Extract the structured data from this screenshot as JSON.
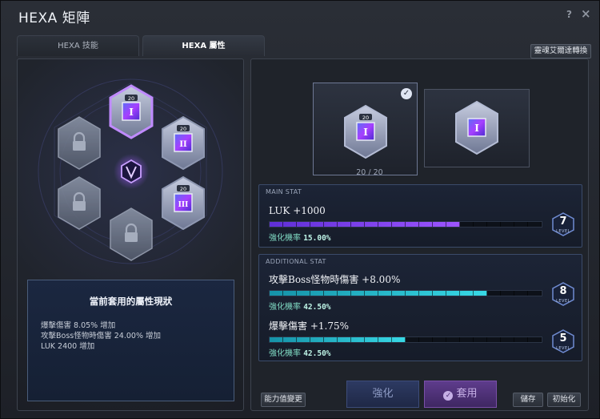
{
  "window": {
    "title": "HEXA 矩陣",
    "help_icon": "?",
    "close_icon": "×"
  },
  "tabs": [
    {
      "label": "HEXA 技能"
    },
    {
      "label": "HEXA 屬性"
    }
  ],
  "convert_button": "靈魂艾爾達轉換",
  "left": {
    "nodes": [
      {
        "level": "20",
        "state": "selected",
        "roman": "I"
      },
      {
        "level": "20",
        "state": "unlocked",
        "roman": "II"
      },
      {
        "level": "20",
        "state": "unlocked",
        "roman": "III"
      },
      {
        "state": "locked"
      },
      {
        "state": "locked"
      },
      {
        "state": "locked"
      }
    ],
    "status": {
      "title": "當前套用的屬性現狀",
      "lines": [
        "爆擊傷害 8.05% 增加",
        "攻擊Boss怪物時傷害 24.00% 增加",
        "LUK 2400 增加"
      ]
    }
  },
  "right": {
    "cards": [
      {
        "level": "20",
        "roman": "I",
        "checked": true
      },
      {
        "roman": "I",
        "checked": false
      }
    ],
    "count": {
      "current": "20",
      "sep": "/",
      "max": "20"
    },
    "main_stat": {
      "header": "MAIN STAT",
      "name": "LUK +1000",
      "prob_label": "強化機率",
      "prob_value": "15.00%",
      "level": "7",
      "level_label": "LEVEL",
      "progress": 0.7
    },
    "additional_stat": {
      "header": "ADDITIONAL STAT",
      "stats": [
        {
          "name": "攻擊Boss怪物時傷害 +8.00%",
          "prob_label": "強化機率",
          "prob_value": "42.50%",
          "level": "8",
          "level_label": "LEVEL",
          "progress": 0.8
        },
        {
          "name": "爆擊傷害 +1.75%",
          "prob_label": "強化機率",
          "prob_value": "42.50%",
          "level": "5",
          "level_label": "LEVEL",
          "progress": 0.5
        }
      ]
    }
  },
  "footer": {
    "change_ability": "能力值變更",
    "enhance": "強化",
    "apply": "套用",
    "save": "儲存",
    "reset": "初始化"
  },
  "colors": {
    "main_bar": "#8a4dff",
    "additional_bar": "#29c7d8",
    "accent": "#a46cff"
  }
}
